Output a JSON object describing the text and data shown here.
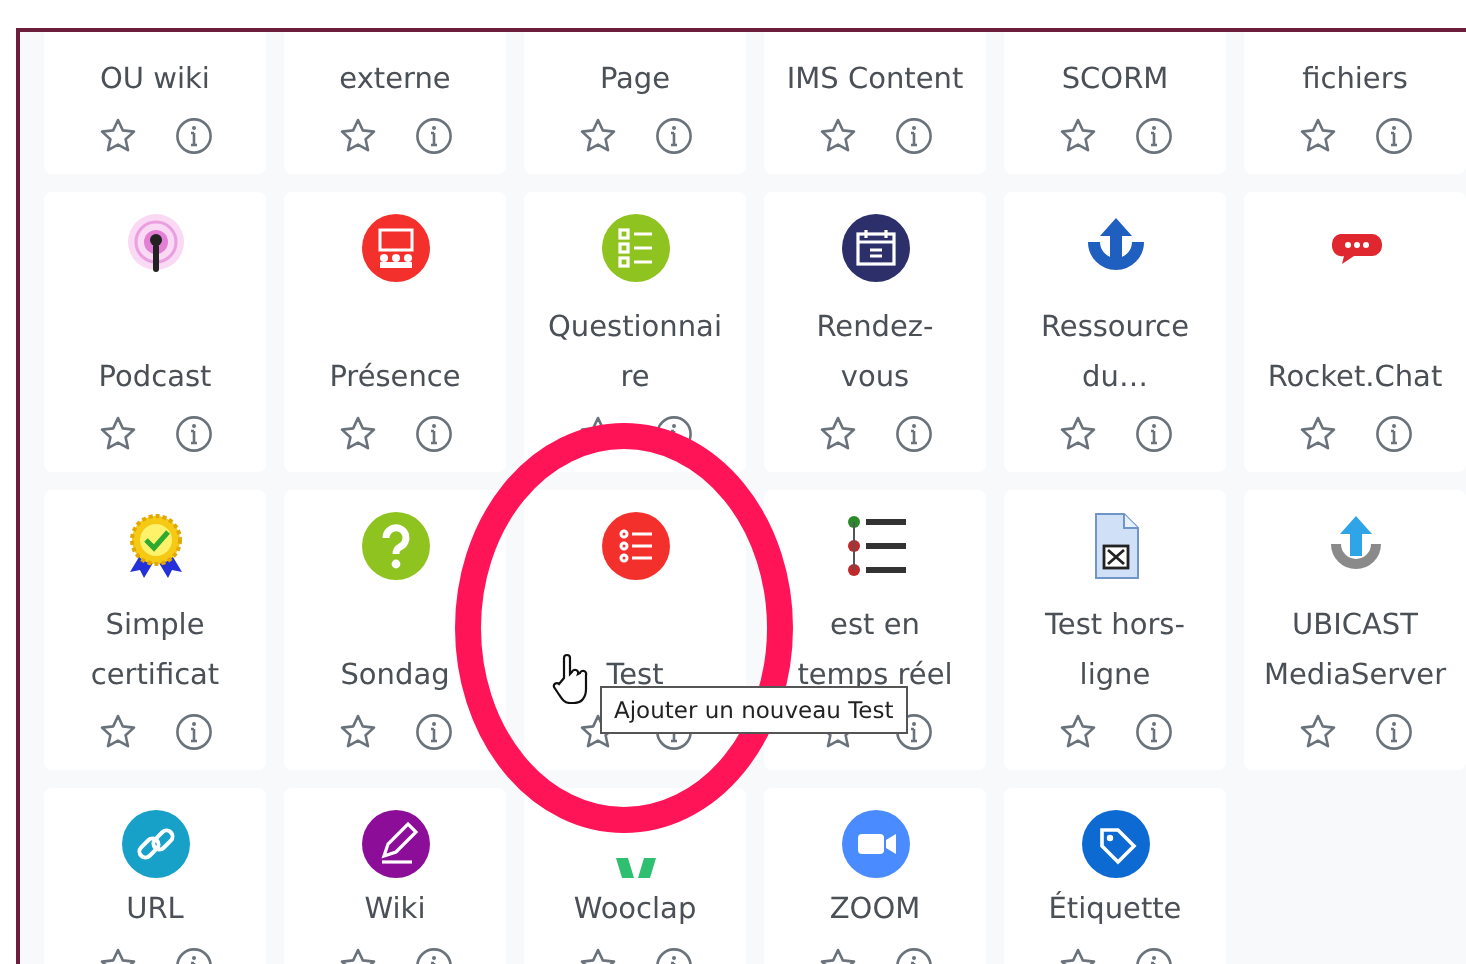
{
  "rows": [
    {
      "cards": [
        {
          "lines": [
            "OU wiki"
          ]
        },
        {
          "lines": [
            "externe"
          ]
        },
        {
          "lines": [
            "Page"
          ]
        },
        {
          "lines": [
            "IMS Content"
          ]
        },
        {
          "lines": [
            "SCORM"
          ]
        },
        {
          "lines": [
            "fichiers"
          ]
        }
      ]
    },
    {
      "cards": [
        {
          "lines": [
            "Podcast"
          ]
        },
        {
          "lines": [
            "Présence"
          ]
        },
        {
          "lines": [
            "Questionnai",
            "re"
          ]
        },
        {
          "lines": [
            "Rendez-",
            "vous"
          ]
        },
        {
          "lines": [
            "Ressource",
            "du…"
          ]
        },
        {
          "lines": [
            "Rocket.Chat"
          ]
        }
      ]
    },
    {
      "cards": [
        {
          "lines": [
            "Simple",
            "certificat"
          ]
        },
        {
          "lines": [
            "Sondag"
          ]
        },
        {
          "lines": [
            "Test"
          ]
        },
        {
          "lines": [
            "est en",
            "temps réel"
          ]
        },
        {
          "lines": [
            "Test hors-",
            "ligne"
          ]
        },
        {
          "lines": [
            "UBICAST",
            "MediaServer"
          ]
        }
      ]
    },
    {
      "cards": [
        {
          "lines": [
            "URL"
          ]
        },
        {
          "lines": [
            "Wiki"
          ]
        },
        {
          "lines": [
            "Wooclap"
          ]
        },
        {
          "lines": [
            "ZOOM"
          ]
        },
        {
          "lines": [
            "Étiquette"
          ]
        }
      ]
    }
  ],
  "tooltip": {
    "text": "Ajouter un nouveau Test"
  }
}
